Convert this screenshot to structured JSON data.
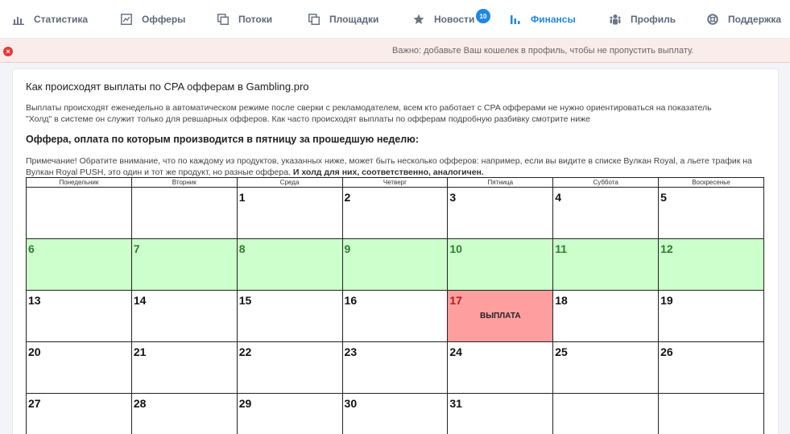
{
  "nav": {
    "items": [
      {
        "label": "Статистика"
      },
      {
        "label": "Офферы"
      },
      {
        "label": "Потоки"
      },
      {
        "label": "Площадки"
      },
      {
        "label": "Новости",
        "badge": "10"
      },
      {
        "label": "Финансы"
      },
      {
        "label": "Профиль"
      },
      {
        "label": "Поддержка"
      }
    ],
    "active": "Финансы",
    "accent": "#1e88e5"
  },
  "alert": {
    "message": "Важно: добавьте Ваш кошелек в профиль, чтобы не пропустить выплату.",
    "icon": "close-circle-icon",
    "color": "#e53935"
  },
  "content": {
    "title": "Как происходят выплаты по CPA офферам в Gambling.pro",
    "paragraph": "Выплаты происходят еженедельно в автоматическом режиме после сверки с рекламодателем, всем кто работает с CPA офферами не нужно ориентироваться на показатель \"Холд\" в системе он служит только для ревшарных офферов. Как часто происходят выплаты по офферам подробную разбивку смотрите ниже",
    "subtitle": "Офферa, оплата по которым производится в пятницу за прошедшую неделю:",
    "note": "Примечание! Обратите внимание, что по каждому из продуктов, указанных ниже, может быть несколько офферов: например, если вы видите в списке Вулкан Royal, а льете трафик на Вулкан Royal PUSH, это один и тот же продукт, но разные оффера.",
    "note_bold": "И холд для них, соответственно, аналогичен."
  },
  "calendar": {
    "weekdays": [
      "Понедельник",
      "Вторник",
      "Среда",
      "Четверг",
      "Пятница",
      "Суббота",
      "Воскресенье"
    ],
    "weeks": [
      [
        {
          "n": ""
        },
        {
          "n": ""
        },
        {
          "n": "1"
        },
        {
          "n": "2"
        },
        {
          "n": "3"
        },
        {
          "n": "4"
        },
        {
          "n": "5"
        }
      ],
      [
        {
          "n": "6",
          "s": "green"
        },
        {
          "n": "7",
          "s": "green"
        },
        {
          "n": "8",
          "s": "green"
        },
        {
          "n": "9",
          "s": "green"
        },
        {
          "n": "10",
          "s": "green"
        },
        {
          "n": "11",
          "s": "green"
        },
        {
          "n": "12",
          "s": "green"
        }
      ],
      [
        {
          "n": "13"
        },
        {
          "n": "14"
        },
        {
          "n": "15"
        },
        {
          "n": "16"
        },
        {
          "n": "17",
          "s": "pay",
          "label": "ВЫПЛАТА"
        },
        {
          "n": "18"
        },
        {
          "n": "19"
        }
      ],
      [
        {
          "n": "20"
        },
        {
          "n": "21"
        },
        {
          "n": "22"
        },
        {
          "n": "23"
        },
        {
          "n": "24"
        },
        {
          "n": "25"
        },
        {
          "n": "26"
        }
      ],
      [
        {
          "n": "27"
        },
        {
          "n": "28"
        },
        {
          "n": "29"
        },
        {
          "n": "30"
        },
        {
          "n": "31"
        },
        {
          "n": ""
        },
        {
          "n": ""
        }
      ]
    ],
    "colors": {
      "highlight_week": "#ccffcc",
      "payout_day": "#ff9e9e"
    }
  }
}
